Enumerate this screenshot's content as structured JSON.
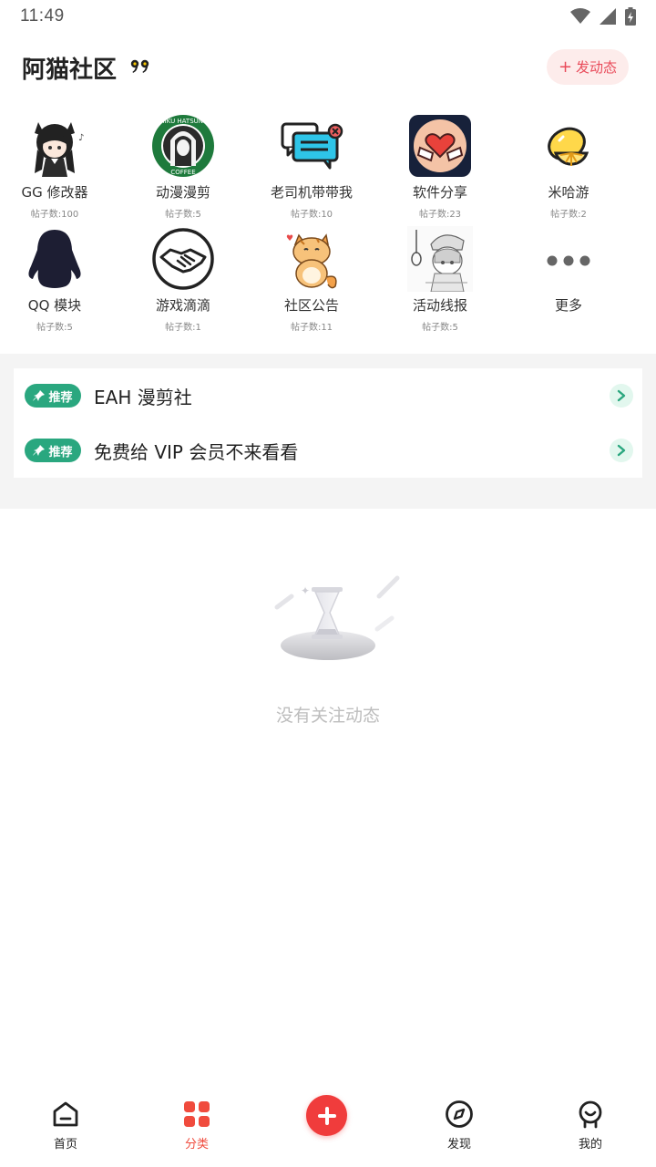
{
  "status_bar": {
    "time": "11:49"
  },
  "header": {
    "title": "阿猫社区",
    "post_button_plus": "+",
    "post_button_label": "发动态"
  },
  "categories": [
    {
      "name": "GG 修改器",
      "count": "帖子数:100",
      "icon": "anime-girl-avatar"
    },
    {
      "name": "动漫漫剪",
      "count": "帖子数:5",
      "icon": "coffee-badge-logo"
    },
    {
      "name": "老司机带带我",
      "count": "帖子数:10",
      "icon": "chat-bubbles-icon"
    },
    {
      "name": "软件分享",
      "count": "帖子数:23",
      "icon": "heart-hands-icon"
    },
    {
      "name": "米哈游",
      "count": "帖子数:2",
      "icon": "lemon-slice-icon"
    },
    {
      "name": "QQ 模块",
      "count": "帖子数:5",
      "icon": "penguin-icon"
    },
    {
      "name": "游戏滴滴",
      "count": "帖子数:1",
      "icon": "handshake-icon"
    },
    {
      "name": "社区公告",
      "count": "帖子数:11",
      "icon": "cat-sticker-icon"
    },
    {
      "name": "活动线报",
      "count": "帖子数:5",
      "icon": "manga-sketch-icon"
    },
    {
      "name": "更多",
      "count": "",
      "icon": "more-dots-icon"
    }
  ],
  "recommendations": [
    {
      "badge": "推荐",
      "title": "EAH 漫剪社"
    },
    {
      "badge": "推荐",
      "title": "免费给 VIP 会员不来看看"
    }
  ],
  "empty_state": {
    "message": "没有关注动态"
  },
  "bottom_nav": {
    "items": [
      {
        "label": "首页",
        "icon": "home-icon"
      },
      {
        "label": "分类",
        "icon": "category-grid-icon",
        "active": true
      },
      {
        "label": "发现",
        "icon": "compass-icon"
      },
      {
        "label": "我的",
        "icon": "profile-icon"
      }
    ]
  },
  "colors": {
    "accent_red": "#f04b3d",
    "recommend_green": "#2aa77f",
    "post_button_bg": "#fdeceb",
    "post_button_text": "#e94b5a"
  }
}
